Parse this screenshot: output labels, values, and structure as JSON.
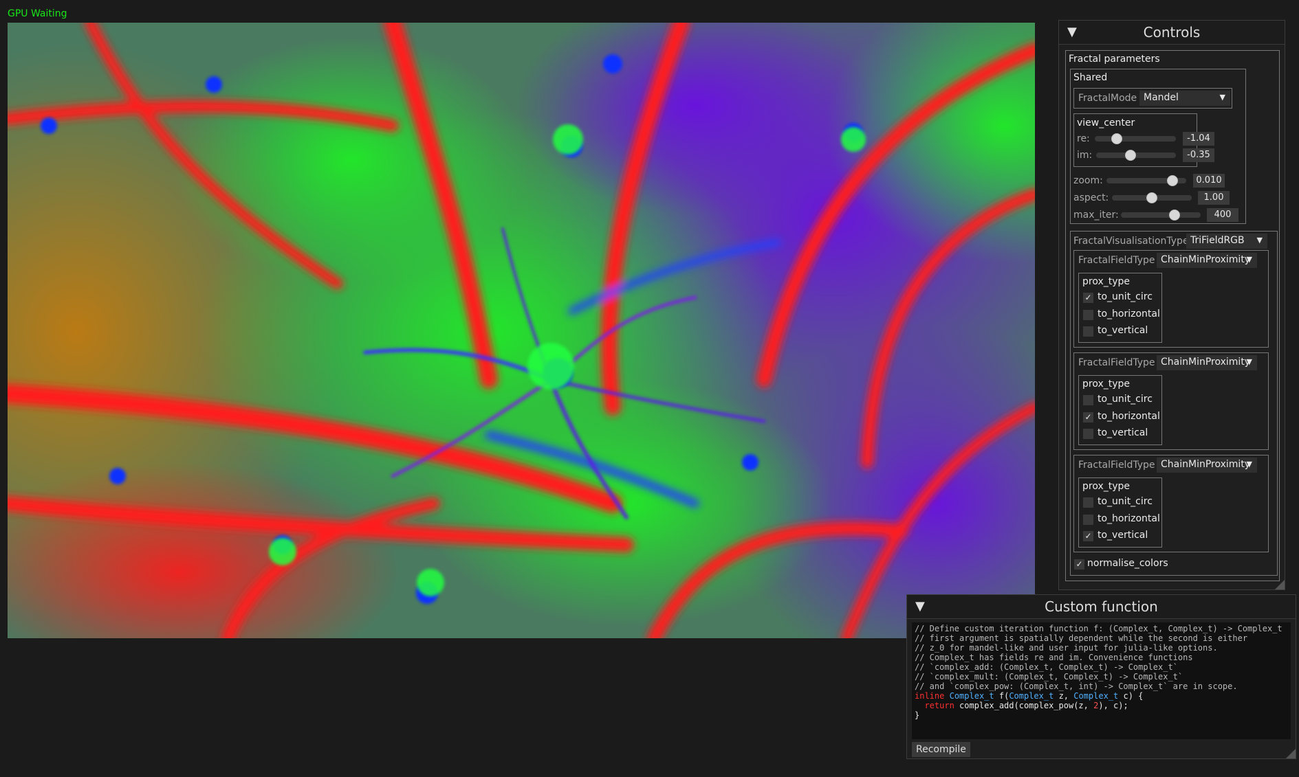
{
  "status": "GPU Waiting",
  "controls": {
    "title": "Controls",
    "collapse_icon": "triangle-down-icon",
    "fractal_params_label": "Fractal parameters",
    "shared_label": "Shared",
    "fractal_mode": {
      "label": "FractalMode",
      "value": "Mandel"
    },
    "view_center": {
      "label": "view_center",
      "re": {
        "label": "re:",
        "value": "-1.04"
      },
      "im": {
        "label": "im:",
        "value": "-0.35"
      }
    },
    "zoom": {
      "label": "zoom:",
      "value": "0.010"
    },
    "aspect": {
      "label": "aspect:",
      "value": "1.00"
    },
    "max_iter": {
      "label": "max_iter:",
      "value": "400"
    },
    "visualisation_type": {
      "label": "FractalVisualisationType",
      "value": "TriFieldRGB"
    },
    "fields": [
      {
        "label": "FractalFieldType",
        "value": "ChainMinProximity",
        "prox_label": "prox_type",
        "options": [
          {
            "label": "to_unit_circ",
            "checked": true
          },
          {
            "label": "to_horizontal",
            "checked": false
          },
          {
            "label": "to_vertical",
            "checked": false
          }
        ]
      },
      {
        "label": "FractalFieldType",
        "value": "ChainMinProximity",
        "prox_label": "prox_type",
        "options": [
          {
            "label": "to_unit_circ",
            "checked": false
          },
          {
            "label": "to_horizontal",
            "checked": true
          },
          {
            "label": "to_vertical",
            "checked": false
          }
        ]
      },
      {
        "label": "FractalFieldType",
        "value": "ChainMinProximity",
        "prox_label": "prox_type",
        "options": [
          {
            "label": "to_unit_circ",
            "checked": false
          },
          {
            "label": "to_horizontal",
            "checked": false
          },
          {
            "label": "to_vertical",
            "checked": true
          }
        ]
      }
    ],
    "normalise_colors": {
      "label": "normalise_colors",
      "checked": true
    }
  },
  "custom_function": {
    "title": "Custom function",
    "code_lines": [
      "// Define custom iteration function f: (Complex_t, Complex_t) -> Complex_t",
      "// first argument is spatially dependent while the second is either",
      "// z_0 for mandel-like and user input for julia-like options.",
      "// Complex_t has fields re and im. Convenience functions",
      "// `complex_add: (Complex_t, Complex_t) -> Complex_t`",
      "// `complex_mult: (Complex_t, Complex_t) -> Complex_t`",
      "// and `complex_pow: (Complex_t, int) -> Complex_t` are in scope."
    ],
    "code_sig": {
      "kw": "inline",
      "type1": "Complex_t",
      "fn": "f(",
      "type2": "Complex_t",
      "arg1": " z, ",
      "type3": "Complex_t",
      "arg2": " c) {"
    },
    "code_body": {
      "kw": "return",
      "call": " complex_add(complex_pow(z, ",
      "num": "2",
      "rest": "), c);"
    },
    "code_close": "}",
    "recompile_label": "Recompile"
  },
  "colors": {
    "status_green": "#19e619",
    "panel_bg": "#1f1f1f",
    "code_keyword": "#ff3030",
    "code_type": "#4fb0ff"
  }
}
